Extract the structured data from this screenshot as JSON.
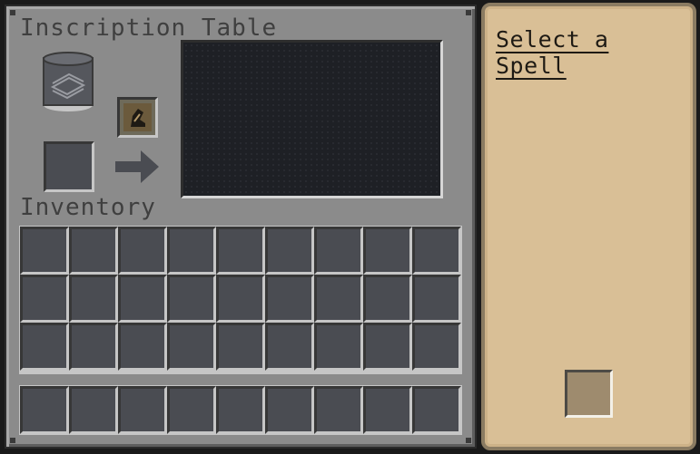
{
  "inscription_table": {
    "title": "Inscription Table",
    "inventory_label": "Inventory",
    "icons": {
      "book_slot_icon": "book-icon",
      "quill_icon": "quill-icon",
      "arrow_icon": "right-arrow-icon"
    },
    "inventory_rows": 3,
    "hotbar_rows": 1,
    "columns": 9
  },
  "spell_panel": {
    "title": "Select a Spell"
  },
  "colors": {
    "panel_gray": "#8b8b8b",
    "slot_dark": "#4a4c52",
    "parchment": "#d9bf96",
    "display_bg": "#1e2025"
  }
}
